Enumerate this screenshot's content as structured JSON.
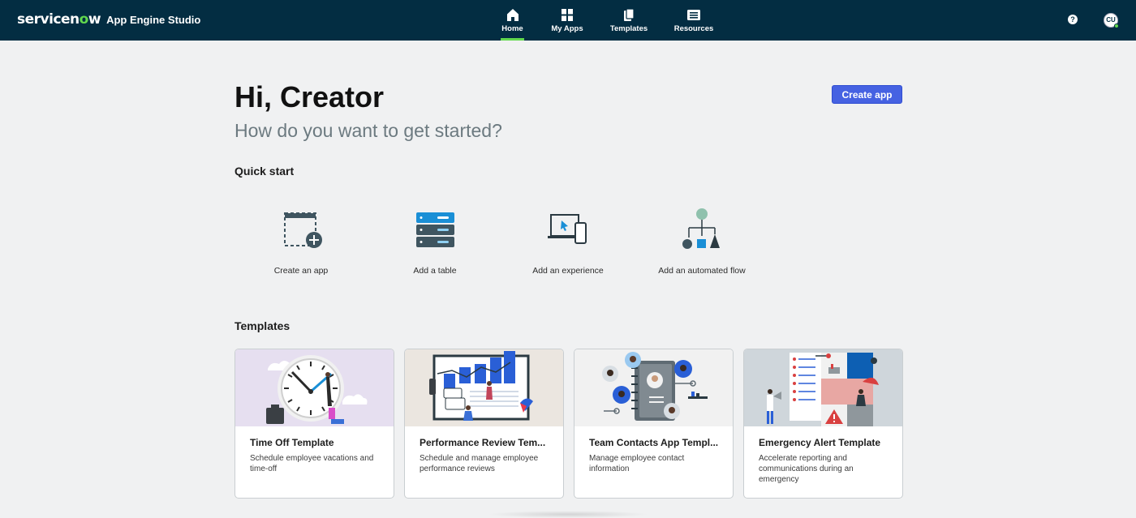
{
  "header": {
    "brand_part1": "servicen",
    "brand_o": "o",
    "brand_part2": "w",
    "app_name": "App Engine Studio",
    "nav": [
      {
        "label": "Home",
        "icon": "home-icon",
        "active": true
      },
      {
        "label": "My Apps",
        "icon": "apps-grid-icon",
        "active": false
      },
      {
        "label": "Templates",
        "icon": "templates-icon",
        "active": false
      },
      {
        "label": "Resources",
        "icon": "resources-icon",
        "active": false
      }
    ],
    "help_label": "?",
    "user_initials": "CU"
  },
  "main": {
    "greeting": "Hi, Creator",
    "subtitle": "How do you want to get started?",
    "create_app_label": "Create app",
    "quick_start": {
      "title": "Quick start",
      "items": [
        {
          "label": "Create an app",
          "icon": "create-app-icon"
        },
        {
          "label": "Add a table",
          "icon": "database-icon"
        },
        {
          "label": "Add an experience",
          "icon": "devices-icon"
        },
        {
          "label": "Add an automated flow",
          "icon": "flow-icon"
        }
      ]
    },
    "templates": {
      "title": "Templates",
      "cards": [
        {
          "title": "Time Off Template",
          "description": "Schedule employee vacations and time-off"
        },
        {
          "title": "Performance Review Tem...",
          "description": "Schedule and manage employee performance reviews"
        },
        {
          "title": "Team Contacts App Templ...",
          "description": "Manage employee contact information"
        },
        {
          "title": "Emergency Alert Template",
          "description": "Accelerate reporting and communications during an emergency"
        }
      ]
    }
  },
  "colors": {
    "topbar": "#032d42",
    "accent_green": "#62d84e",
    "primary_button": "#4662e2",
    "page_background": "#f0f1f2"
  }
}
